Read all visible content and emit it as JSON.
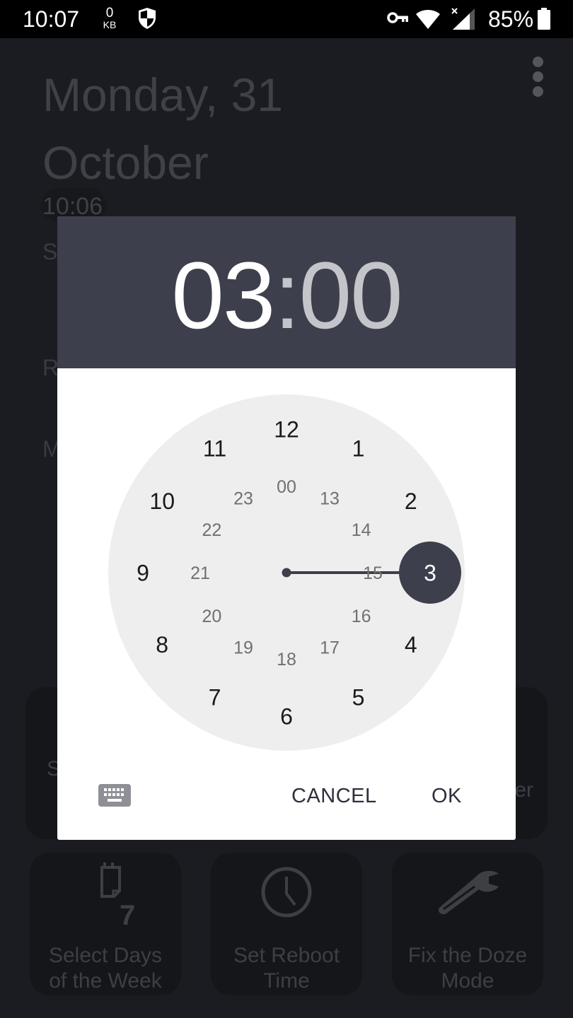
{
  "status_bar": {
    "time": "10:07",
    "data_rate_value": "0",
    "data_rate_unit": "KB",
    "battery_percent": "85%",
    "icons": [
      "shield-icon",
      "vpn-key-icon",
      "wifi-icon",
      "cell-signal-no-data-icon",
      "battery-icon"
    ]
  },
  "background_app": {
    "date_line1": "Monday, 31",
    "date_line2": "October",
    "current_time": "10:06",
    "partial_labels": [
      "S",
      "R",
      "M"
    ],
    "menu_icon": "more-vert-icon",
    "cards_row1_partial": [
      {
        "visible_text": "S"
      },
      {
        "visible_text": "er"
      }
    ],
    "cards": [
      {
        "label_line1": "Select Days",
        "label_line2": "of the Week",
        "icon": "calendar-7-icon"
      },
      {
        "label_line1": "Set Reboot",
        "label_line2": "Time",
        "icon": "clock-icon"
      },
      {
        "label_line1": "Fix the Doze",
        "label_line2": "Mode",
        "icon": "wrench-icon"
      }
    ]
  },
  "time_picker": {
    "hours": "03",
    "separator": ":",
    "minutes": "00",
    "mode": "hour",
    "selected_hour": 3,
    "outer_ring": [
      "12",
      "1",
      "2",
      "3",
      "4",
      "5",
      "6",
      "7",
      "8",
      "9",
      "10",
      "11"
    ],
    "inner_ring": [
      "00",
      "13",
      "14",
      "15",
      "16",
      "17",
      "18",
      "19",
      "20",
      "21",
      "22",
      "23"
    ],
    "cancel_label": "CANCEL",
    "ok_label": "OK",
    "keyboard_icon": "keyboard-icon",
    "colors": {
      "header_bg": "#3e3f4c",
      "accent": "#3e3f4c",
      "face_bg": "#eeeeee",
      "button_text": "#2d2f3e"
    }
  }
}
